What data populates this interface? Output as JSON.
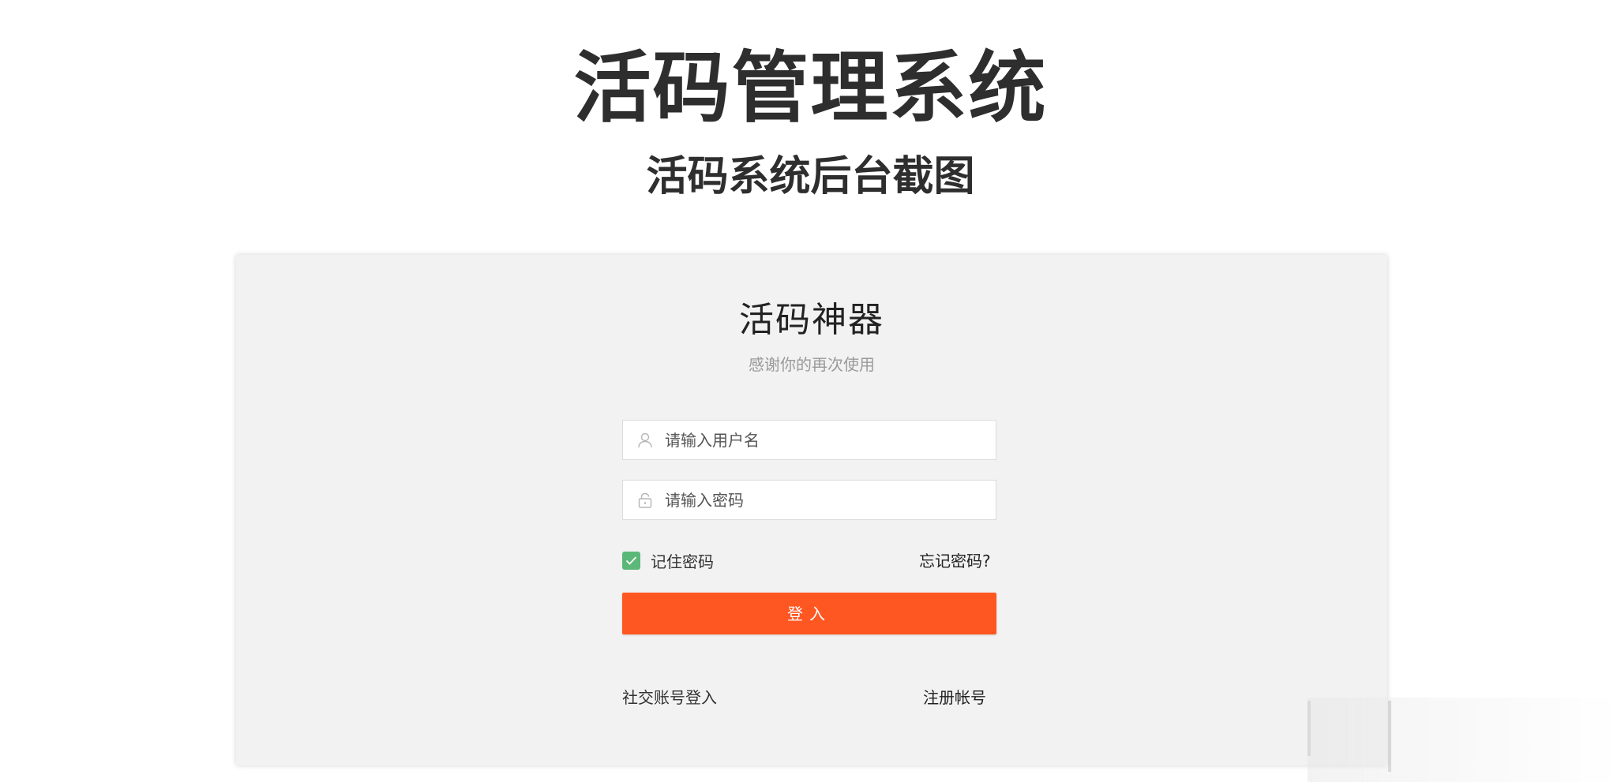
{
  "header": {
    "title": "活码管理系统",
    "subtitle": "活码系统后台截图"
  },
  "login": {
    "title": "活码神器",
    "subtitle": "感谢你的再次使用",
    "username_placeholder": "请输入用户名",
    "password_placeholder": "请输入密码",
    "remember_label": "记住密码",
    "remember_checked": true,
    "forgot_label": "忘记密码?",
    "submit_label": "登入",
    "social_label": "社交账号登入",
    "register_label": "注册帐号"
  },
  "icons": {
    "username": "user-icon",
    "password": "lock-icon",
    "checkbox": "check-icon"
  },
  "colors": {
    "accent": "#ff5722",
    "checkbox": "#5cb878",
    "panel_bg": "#f2f2f2",
    "title": "#2e2e2e"
  }
}
